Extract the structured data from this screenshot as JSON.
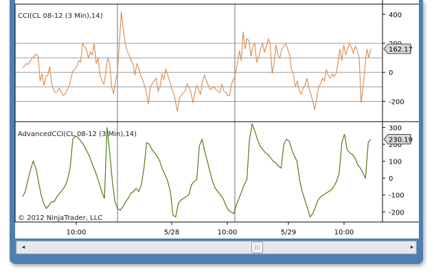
{
  "copyright": "© 2012 NinjaTrader, LLC",
  "scrollbar": {
    "left_arrow": "◂",
    "right_arrow": "▸",
    "thumb_position": 0.61
  },
  "chart_data": [
    {
      "type": "line",
      "title": "CCI(CL 08-12 (3 Min),14)",
      "series": [
        {
          "color": "#d9915a",
          "values": [
            30,
            45,
            60,
            55,
            80,
            100,
            110,
            125,
            110,
            -60,
            -10,
            -90,
            -30,
            -20,
            40,
            -80,
            -120,
            -140,
            -130,
            -110,
            -140,
            -160,
            -150,
            -120,
            -100,
            -40,
            10,
            20,
            40,
            80,
            70,
            200,
            180,
            150,
            100,
            140,
            120,
            200,
            60,
            100,
            -20,
            -60,
            -80,
            0,
            100,
            60,
            -100,
            -150,
            -60,
            0,
            200,
            420,
            300,
            200,
            150,
            120,
            80,
            60,
            -20,
            60,
            30,
            -20,
            -50,
            -90,
            -140,
            -220,
            -100,
            -80,
            -60,
            -40,
            -130,
            -100,
            -10,
            -50,
            20,
            -20,
            -60,
            -110,
            -140,
            -200,
            -270,
            -180,
            -160,
            -140,
            -130,
            -80,
            -100,
            -140,
            -210,
            -140,
            -90,
            -120,
            -150,
            -60,
            -20,
            -60,
            -90,
            -120,
            -110,
            -100,
            -120,
            -130,
            -140,
            -80,
            -130,
            -140,
            -160,
            -160,
            -80,
            -50,
            -10,
            60,
            150,
            80,
            280,
            160,
            230,
            220,
            110,
            180,
            200,
            70,
            100,
            160,
            200,
            140,
            180,
            230,
            190,
            -10,
            70,
            190,
            120,
            100,
            160,
            180,
            200,
            160,
            120,
            20,
            -10,
            -100,
            -60,
            -120,
            -150,
            -110,
            -90,
            -40,
            -110,
            -150,
            -200,
            -260,
            -180,
            -100,
            -80,
            -40,
            -60,
            20,
            -20,
            -40,
            -10,
            -30,
            -10,
            60,
            160,
            80,
            190,
            120,
            160,
            200,
            170,
            130,
            180,
            150,
            100,
            -210,
            -100,
            40,
            160,
            100,
            162.17
          ]
        }
      ],
      "ylim": [
        -340,
        470
      ],
      "yticks": [
        400,
        200,
        0,
        -200
      ],
      "hlines": [
        200,
        100,
        0,
        -100,
        -200
      ],
      "last_value": "162.17"
    },
    {
      "type": "line",
      "title": "AdvancedCCI(CL 08-12 (3 Min),14)",
      "series": [
        {
          "color": "#4f7a18",
          "values": [
            -110,
            -80,
            -10,
            50,
            100,
            60,
            -20,
            -100,
            -150,
            -180,
            -160,
            -140,
            -140,
            -110,
            -90,
            -70,
            -50,
            -10,
            60,
            230,
            250,
            240,
            220,
            200,
            170,
            140,
            100,
            60,
            20,
            -30,
            -80,
            -120,
            300,
            150,
            -20,
            -140,
            -180,
            -190,
            -170,
            -140,
            -120,
            -90,
            -80,
            -60,
            -80,
            -40,
            60,
            210,
            200,
            170,
            150,
            130,
            100,
            50,
            20,
            -20,
            -80,
            -220,
            -230,
            -150,
            -130,
            -120,
            -110,
            -100,
            -40,
            -20,
            -10,
            190,
            230,
            160,
            100,
            40,
            -20,
            -60,
            -80,
            -100,
            -120,
            -160,
            -190,
            -200,
            -210,
            -160,
            -120,
            -80,
            -40,
            -10,
            230,
            320,
            280,
            230,
            190,
            170,
            150,
            140,
            120,
            100,
            90,
            70,
            60,
            200,
            230,
            220,
            170,
            130,
            100,
            -10,
            -80,
            -130,
            -180,
            -230,
            -210,
            -170,
            -130,
            -110,
            -100,
            -90,
            -80,
            -70,
            -50,
            -20,
            30,
            210,
            260,
            170,
            150,
            140,
            120,
            80,
            60,
            30,
            0,
            210,
            230.19
          ]
        }
      ],
      "ylim": [
        -260,
        330
      ],
      "yticks": [
        300,
        200,
        100,
        0,
        -100,
        -200
      ],
      "last_value": "230.19"
    }
  ],
  "x_axis": {
    "labels": [
      "10:00",
      "5/28",
      "10:00",
      "5/29",
      "10:00"
    ]
  }
}
